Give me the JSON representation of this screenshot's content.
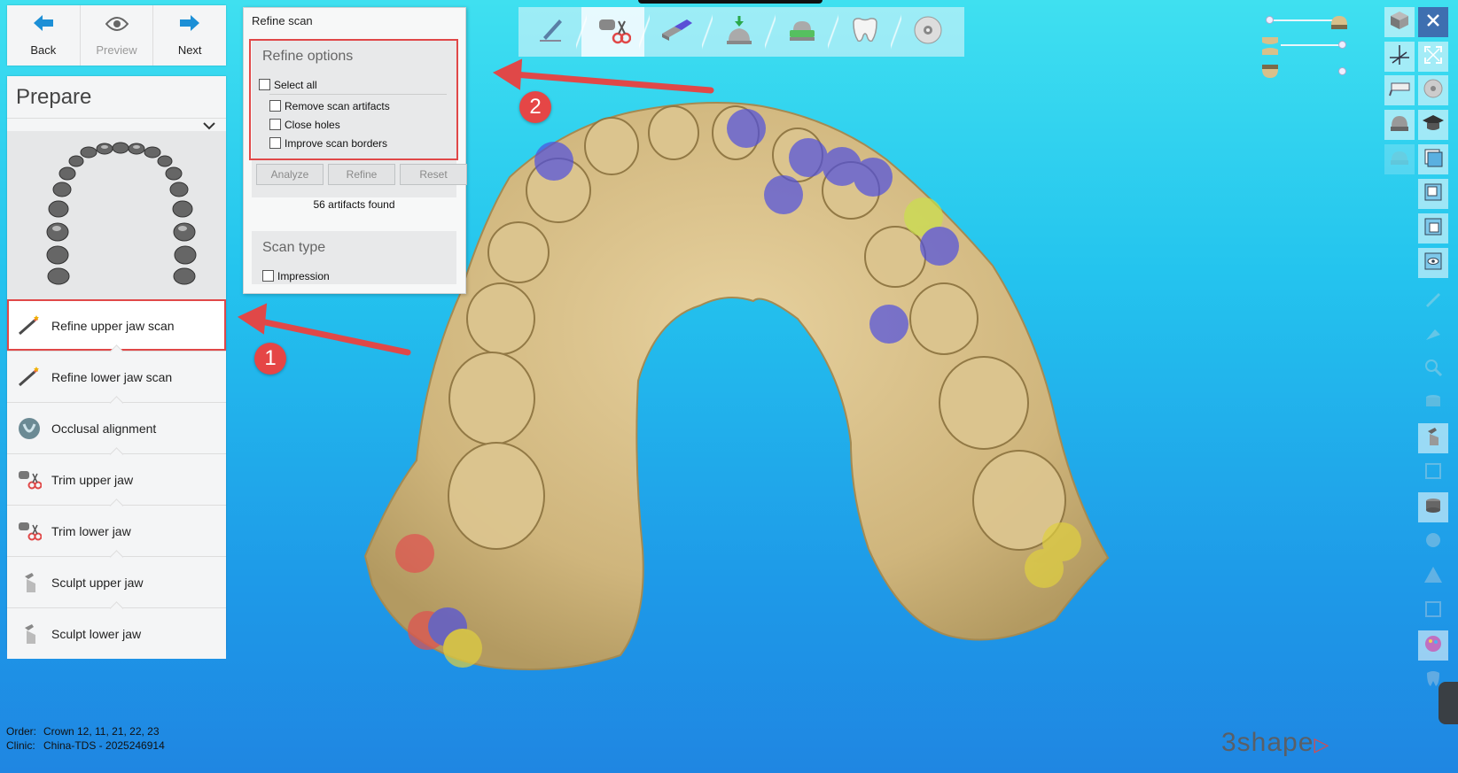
{
  "nav": {
    "back_label": "Back",
    "preview_label": "Preview",
    "next_label": "Next"
  },
  "prepare": {
    "title": "Prepare",
    "steps": [
      {
        "label": "Refine upper jaw scan",
        "icon": "wand-icon",
        "active": true
      },
      {
        "label": "Refine lower jaw scan",
        "icon": "wand-icon",
        "active": false
      },
      {
        "label": "Occlusal alignment",
        "icon": "occlusion-icon",
        "active": false
      },
      {
        "label": "Trim upper jaw",
        "icon": "scissors-icon",
        "active": false
      },
      {
        "label": "Trim lower jaw",
        "icon": "scissors-icon",
        "active": false
      },
      {
        "label": "Sculpt upper jaw",
        "icon": "sculpt-icon",
        "active": false
      },
      {
        "label": "Sculpt lower jaw",
        "icon": "sculpt-icon",
        "active": false
      }
    ]
  },
  "dialog": {
    "title": "Refine scan",
    "refine_options": {
      "heading": "Refine options",
      "select_all": "Select all",
      "options": [
        "Remove scan artifacts",
        "Close holes",
        "Improve scan borders"
      ]
    },
    "buttons": {
      "analyze": "Analyze",
      "refine": "Refine",
      "reset": "Reset"
    },
    "status": "56 artifacts found",
    "scan_type": {
      "heading": "Scan type",
      "impression": "Impression"
    }
  },
  "toolbar": {
    "items": [
      "pen-icon",
      "scissors-tool-icon",
      "model-tool-icon",
      "die-icon",
      "base-icon",
      "crown-icon",
      "disc-icon"
    ],
    "active_index": 1
  },
  "annotations": {
    "badge1": "1",
    "badge2": "2"
  },
  "info": {
    "order_key": "Order:",
    "order_value": "Crown 12, 11, 21, 22, 23",
    "clinic_key": "Clinic:",
    "clinic_value": "China-TDS - 2025246914"
  },
  "logo": {
    "text": "3shape"
  },
  "colors": {
    "accent": "#1c8fd6",
    "highlight": "#e04848",
    "scan": "#d8c08a"
  }
}
